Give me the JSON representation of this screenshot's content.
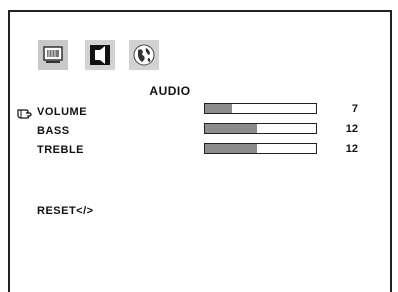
{
  "menu": {
    "tabs": [
      {
        "icon": "monitor-icon",
        "label": ""
      },
      {
        "icon": "speaker-icon",
        "label": ""
      },
      {
        "icon": "globe-icon",
        "label": ""
      }
    ],
    "title": "AUDIO",
    "items": [
      {
        "label": "VOLUME",
        "value": "7",
        "level_fraction": 0.24,
        "selected": true
      },
      {
        "label": "BASS",
        "value": "12",
        "level_fraction": 0.47,
        "selected": false
      },
      {
        "label": "TREBLE",
        "value": "12",
        "level_fraction": 0.47,
        "selected": false
      }
    ],
    "reset_label": "RESET</>"
  },
  "colors": {
    "bar_fill": "#8c8c8c",
    "border": "#222222",
    "icon_bg": "#c9c9c9"
  }
}
